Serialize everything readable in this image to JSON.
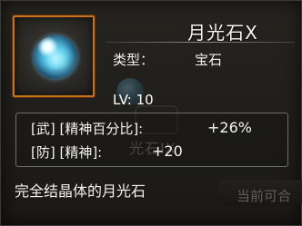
{
  "item": {
    "name": "月光石X",
    "type_label": "类型：",
    "type_value": "宝石",
    "level_label": "LV: 10",
    "stats": [
      {
        "label": "[武]  [精神百分比]:",
        "value": "+26%"
      },
      {
        "label": "[防]  [精神]:",
        "value": "+20"
      }
    ],
    "description": "完全结晶体的月光石",
    "background_hint": "当前可合",
    "watermark_text": "光石IX",
    "icon": "moonstone-gem-icon",
    "accent_color": "#c8701d"
  }
}
